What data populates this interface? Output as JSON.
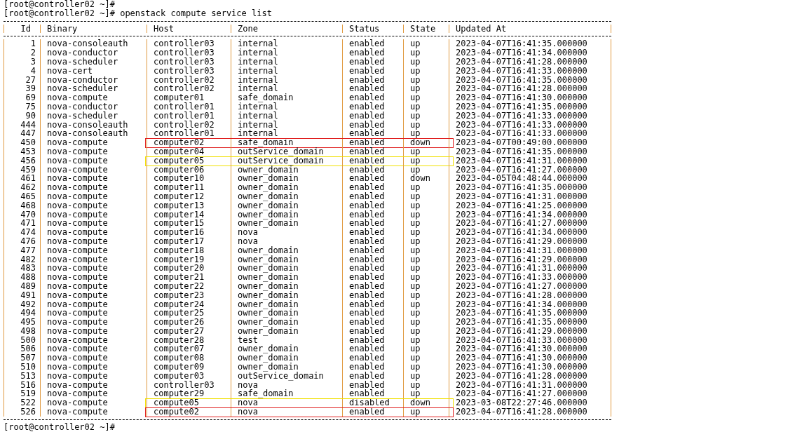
{
  "prompt_top": "[root@controller02 ~]#",
  "command_line": "[root@controller02 ~]# openstack compute service list",
  "table": {
    "columns": [
      "Id",
      "Binary",
      "Host",
      "Zone",
      "Status",
      "State",
      "Updated At"
    ],
    "rows": [
      {
        "id": "1",
        "binary": "nova-consoleauth",
        "host": "controller03",
        "zone": "internal",
        "status": "enabled",
        "state": "up",
        "updated_at": "2023-04-07T16:41:35.000000"
      },
      {
        "id": "2",
        "binary": "nova-conductor",
        "host": "controller03",
        "zone": "internal",
        "status": "enabled",
        "state": "up",
        "updated_at": "2023-04-07T16:41:34.000000"
      },
      {
        "id": "3",
        "binary": "nova-scheduler",
        "host": "controller03",
        "zone": "internal",
        "status": "enabled",
        "state": "up",
        "updated_at": "2023-04-07T16:41:28.000000"
      },
      {
        "id": "4",
        "binary": "nova-cert",
        "host": "controller03",
        "zone": "internal",
        "status": "enabled",
        "state": "up",
        "updated_at": "2023-04-07T16:41:33.000000"
      },
      {
        "id": "27",
        "binary": "nova-conductor",
        "host": "controller02",
        "zone": "internal",
        "status": "enabled",
        "state": "up",
        "updated_at": "2023-04-07T16:41:35.000000"
      },
      {
        "id": "39",
        "binary": "nova-scheduler",
        "host": "controller02",
        "zone": "internal",
        "status": "enabled",
        "state": "up",
        "updated_at": "2023-04-07T16:41:28.000000"
      },
      {
        "id": "69",
        "binary": "nova-compute",
        "host": "computer01",
        "zone": "safe_domain",
        "status": "enabled",
        "state": "up",
        "updated_at": "2023-04-07T16:41:30.000000"
      },
      {
        "id": "75",
        "binary": "nova-conductor",
        "host": "controller01",
        "zone": "internal",
        "status": "enabled",
        "state": "up",
        "updated_at": "2023-04-07T16:41:35.000000"
      },
      {
        "id": "90",
        "binary": "nova-scheduler",
        "host": "controller01",
        "zone": "internal",
        "status": "enabled",
        "state": "up",
        "updated_at": "2023-04-07T16:41:33.000000"
      },
      {
        "id": "444",
        "binary": "nova-consoleauth",
        "host": "controller02",
        "zone": "internal",
        "status": "enabled",
        "state": "up",
        "updated_at": "2023-04-07T16:41:33.000000"
      },
      {
        "id": "447",
        "binary": "nova-consoleauth",
        "host": "controller01",
        "zone": "internal",
        "status": "enabled",
        "state": "up",
        "updated_at": "2023-04-07T16:41:33.000000"
      },
      {
        "id": "450",
        "binary": "nova-compute",
        "host": "computer02",
        "zone": "safe_domain",
        "status": "enabled",
        "state": "down",
        "updated_at": "2023-04-07T00:49:00.000000",
        "color": "#e02020"
      },
      {
        "id": "453",
        "binary": "nova-compute",
        "host": "computer04",
        "zone": "outService_domain",
        "status": "enabled",
        "state": "up",
        "updated_at": "2023-04-07T16:41:35.000000"
      },
      {
        "id": "456",
        "binary": "nova-compute",
        "host": "computer05",
        "zone": "outService_domain",
        "status": "enabled",
        "state": "up",
        "updated_at": "2023-04-07T16:41:31.000000",
        "color": "#f0e000"
      },
      {
        "id": "459",
        "binary": "nova-compute",
        "host": "computer06",
        "zone": "owner_domain",
        "status": "enabled",
        "state": "up",
        "updated_at": "2023-04-07T16:41:27.000000"
      },
      {
        "id": "461",
        "binary": "nova-compute",
        "host": "computer10",
        "zone": "owner_domain",
        "status": "enabled",
        "state": "down",
        "updated_at": "2023-04-05T04:48:44.000000"
      },
      {
        "id": "462",
        "binary": "nova-compute",
        "host": "computer11",
        "zone": "owner_domain",
        "status": "enabled",
        "state": "up",
        "updated_at": "2023-04-07T16:41:35.000000"
      },
      {
        "id": "465",
        "binary": "nova-compute",
        "host": "computer12",
        "zone": "owner_domain",
        "status": "enabled",
        "state": "up",
        "updated_at": "2023-04-07T16:41:31.000000"
      },
      {
        "id": "468",
        "binary": "nova-compute",
        "host": "computer13",
        "zone": "owner_domain",
        "status": "enabled",
        "state": "up",
        "updated_at": "2023-04-07T16:41:25.000000"
      },
      {
        "id": "470",
        "binary": "nova-compute",
        "host": "computer14",
        "zone": "owner_domain",
        "status": "enabled",
        "state": "up",
        "updated_at": "2023-04-07T16:41:34.000000"
      },
      {
        "id": "471",
        "binary": "nova-compute",
        "host": "computer15",
        "zone": "owner_domain",
        "status": "enabled",
        "state": "up",
        "updated_at": "2023-04-07T16:41:27.000000"
      },
      {
        "id": "474",
        "binary": "nova-compute",
        "host": "computer16",
        "zone": "nova",
        "status": "enabled",
        "state": "up",
        "updated_at": "2023-04-07T16:41:34.000000"
      },
      {
        "id": "476",
        "binary": "nova-compute",
        "host": "computer17",
        "zone": "nova",
        "status": "enabled",
        "state": "up",
        "updated_at": "2023-04-07T16:41:29.000000"
      },
      {
        "id": "477",
        "binary": "nova-compute",
        "host": "computer18",
        "zone": "owner_domain",
        "status": "enabled",
        "state": "up",
        "updated_at": "2023-04-07T16:41:31.000000"
      },
      {
        "id": "482",
        "binary": "nova-compute",
        "host": "computer19",
        "zone": "owner_domain",
        "status": "enabled",
        "state": "up",
        "updated_at": "2023-04-07T16:41:29.000000"
      },
      {
        "id": "483",
        "binary": "nova-compute",
        "host": "computer20",
        "zone": "owner_domain",
        "status": "enabled",
        "state": "up",
        "updated_at": "2023-04-07T16:41:31.000000"
      },
      {
        "id": "488",
        "binary": "nova-compute",
        "host": "computer21",
        "zone": "owner_domain",
        "status": "enabled",
        "state": "up",
        "updated_at": "2023-04-07T16:41:33.000000"
      },
      {
        "id": "489",
        "binary": "nova-compute",
        "host": "computer22",
        "zone": "owner_domain",
        "status": "enabled",
        "state": "up",
        "updated_at": "2023-04-07T16:41:27.000000"
      },
      {
        "id": "491",
        "binary": "nova-compute",
        "host": "computer23",
        "zone": "owner_domain",
        "status": "enabled",
        "state": "up",
        "updated_at": "2023-04-07T16:41:28.000000"
      },
      {
        "id": "492",
        "binary": "nova-compute",
        "host": "computer24",
        "zone": "owner_domain",
        "status": "enabled",
        "state": "up",
        "updated_at": "2023-04-07T16:41:34.000000"
      },
      {
        "id": "494",
        "binary": "nova-compute",
        "host": "computer25",
        "zone": "owner_domain",
        "status": "enabled",
        "state": "up",
        "updated_at": "2023-04-07T16:41:35.000000"
      },
      {
        "id": "495",
        "binary": "nova-compute",
        "host": "computer26",
        "zone": "owner_domain",
        "status": "enabled",
        "state": "up",
        "updated_at": "2023-04-07T16:41:35.000000"
      },
      {
        "id": "498",
        "binary": "nova-compute",
        "host": "computer27",
        "zone": "owner_domain",
        "status": "enabled",
        "state": "up",
        "updated_at": "2023-04-07T16:41:29.000000"
      },
      {
        "id": "500",
        "binary": "nova-compute",
        "host": "computer28",
        "zone": "test",
        "status": "enabled",
        "state": "up",
        "updated_at": "2023-04-07T16:41:33.000000"
      },
      {
        "id": "506",
        "binary": "nova-compute",
        "host": "computer07",
        "zone": "owner_domain",
        "status": "enabled",
        "state": "up",
        "updated_at": "2023-04-07T16:41:30.000000"
      },
      {
        "id": "507",
        "binary": "nova-compute",
        "host": "computer08",
        "zone": "owner_domain",
        "status": "enabled",
        "state": "up",
        "updated_at": "2023-04-07T16:41:30.000000"
      },
      {
        "id": "510",
        "binary": "nova-compute",
        "host": "computer09",
        "zone": "owner_domain",
        "status": "enabled",
        "state": "up",
        "updated_at": "2023-04-07T16:41:30.000000"
      },
      {
        "id": "513",
        "binary": "nova-compute",
        "host": "computer03",
        "zone": "outService_domain",
        "status": "enabled",
        "state": "up",
        "updated_at": "2023-04-07T16:41:28.000000"
      },
      {
        "id": "516",
        "binary": "nova-compute",
        "host": "controller03",
        "zone": "nova",
        "status": "enabled",
        "state": "up",
        "updated_at": "2023-04-07T16:41:31.000000"
      },
      {
        "id": "519",
        "binary": "nova-compute",
        "host": "computer29",
        "zone": "safe_domain",
        "status": "enabled",
        "state": "up",
        "updated_at": "2023-04-07T16:41:27.000000"
      },
      {
        "id": "522",
        "binary": "nova-compute",
        "host": "compute05",
        "zone": "nova",
        "status": "disabled",
        "state": "down",
        "updated_at": "2023-03-08T22:27:46.000000",
        "color": "#f0e000"
      },
      {
        "id": "526",
        "binary": "nova-compute",
        "host": "compute02",
        "zone": "nova",
        "status": "enabled",
        "state": "up",
        "updated_at": "2023-04-07T16:41:28.000000",
        "color": "#e02020"
      }
    ]
  },
  "prompt_bottom": "[root@controller02 ~]#"
}
